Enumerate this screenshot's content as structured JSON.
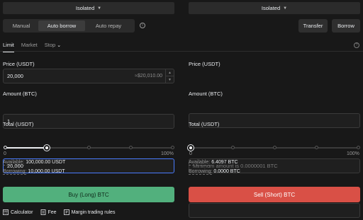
{
  "left_panel": {
    "mode_select": "Isolated",
    "order_modes": [
      "Manual",
      "Auto borrow",
      "Auto repay"
    ],
    "active_order_mode": "Auto borrow",
    "order_tabs": [
      "Limit",
      "Market",
      "Stop"
    ],
    "active_order_tab": "Limit",
    "price_label": "Price (USDT)",
    "price_value": "20,000",
    "price_hint": "≈$20,010.00",
    "amount_label": "Amount (BTC)",
    "amount_value": "1",
    "total_label": "Total (USDT)",
    "total_value": "20,000",
    "slider_min": "0",
    "slider_max": "100%",
    "slider_value_fraction": 0.25,
    "available_label": "Available:",
    "available_value": "100,000.00 USDT",
    "borrowing_label": "Borrowing:",
    "borrowing_value": "10,000.00 USDT",
    "action_button": "Buy (Long) BTC"
  },
  "right_panel": {
    "mode_select": "Isolated",
    "transfer_button": "Transfer",
    "borrow_button": "Borrow",
    "price_label": "Price (USDT)",
    "price_value": "",
    "amount_label": "Amount (BTC)",
    "amount_placeholder": "Minimum amount is 0.0000001 BTC",
    "total_label": "Total (USDT)",
    "total_value": "",
    "slider_min": "0",
    "slider_max": "100%",
    "slider_value_fraction": 0,
    "available_label": "Available:",
    "available_value": "6.4097 BTC",
    "borrowing_label": "Borrowing:",
    "borrowing_value": "0.0000 BTC",
    "action_button": "Sell (Short) BTC"
  },
  "footer": {
    "links": [
      "Calculator",
      "Fee",
      "Margin trading rules"
    ]
  },
  "icons": {
    "info": "info-icon",
    "help": "help-icon",
    "calculator": "calculator-icon",
    "fee": "fee-icon",
    "rules": "rules-icon"
  },
  "colors": {
    "buy": "#52b07d",
    "sell": "#d95046",
    "focus": "#4a7cff",
    "background": "#181818"
  }
}
